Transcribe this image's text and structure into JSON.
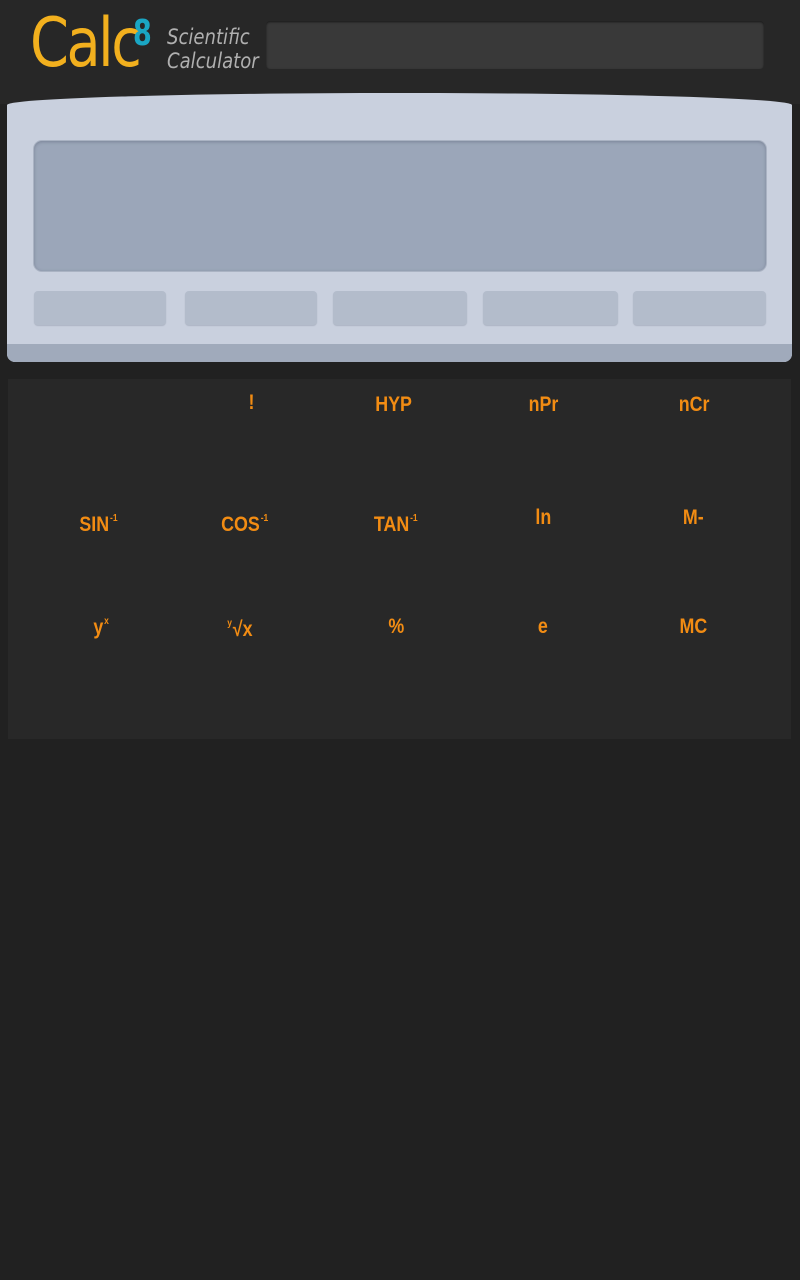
{
  "app": {
    "logo_main": "Calc",
    "logo_superscript": "8",
    "subtitle_line1": "Scientific",
    "subtitle_line2": "Calculator"
  },
  "top_input": {
    "value": "",
    "placeholder": ""
  },
  "display": {
    "screen_text": "",
    "memory_buttons": [
      "",
      "",
      "",
      "",
      ""
    ]
  },
  "keypad": {
    "rows": [
      [
        {
          "label": "",
          "sup": ""
        },
        {
          "label": "!",
          "sup": ""
        },
        {
          "label": "HYP",
          "sup": ""
        },
        {
          "label": "nPr",
          "sup": ""
        },
        {
          "label": "nCr",
          "sup": ""
        }
      ],
      [
        {
          "label": "SIN",
          "sup": "-1"
        },
        {
          "label": "COS",
          "sup": "-1"
        },
        {
          "label": "TAN",
          "sup": "-1"
        },
        {
          "label": "ln",
          "sup": ""
        },
        {
          "label": "M-",
          "sup": ""
        }
      ],
      [
        {
          "label": "y",
          "sup": "x"
        },
        {
          "label": "√x",
          "pre_sup": "y"
        },
        {
          "label": "%",
          "sup": ""
        },
        {
          "label": "e",
          "sup": ""
        },
        {
          "label": "MC",
          "sup": ""
        }
      ]
    ]
  },
  "colors": {
    "background": "#212121",
    "header": "#272727",
    "logo_orange": "#f2b01e",
    "logo_cyan": "#1aa6c4",
    "key_label_orange": "#f28c13",
    "panel": "#c9d0de",
    "screen": "#9ba6b9"
  }
}
